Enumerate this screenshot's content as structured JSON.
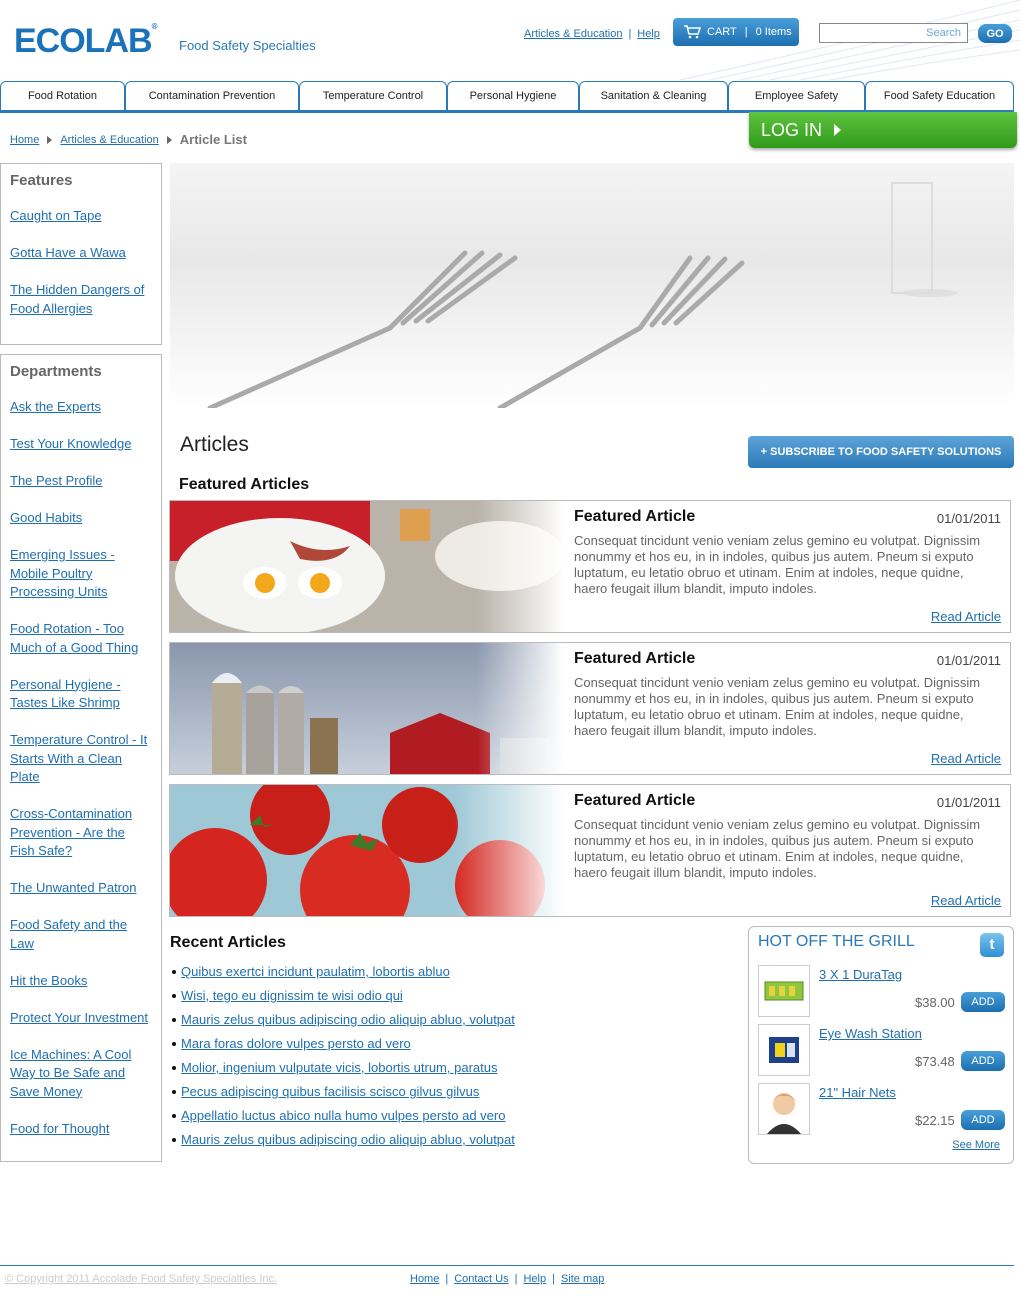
{
  "brand": {
    "logo": "ECOLAB",
    "subtitle": "Food Safety Specialties"
  },
  "toplinks": [
    "Articles & Education",
    "Help"
  ],
  "cart": {
    "label": "CART",
    "items": "0 Items"
  },
  "search": {
    "placeholder": "Search",
    "go": "GO"
  },
  "nav": [
    "Food Rotation",
    "Contamination Prevention",
    "Temperature Control",
    "Personal Hygiene",
    "Sanitation & Cleaning",
    "Employee Safety",
    "Food Safety Education"
  ],
  "breadcrumb": {
    "home": "Home",
    "section": "Articles & Education",
    "current": "Article List"
  },
  "login": "LOG IN",
  "sidebar": {
    "features_title": "Features",
    "features": [
      "Caught on Tape",
      "Gotta Have a Wawa",
      "The Hidden Dangers of Food Allergies"
    ],
    "departments_title": "Departments",
    "departments": [
      "Ask the Experts",
      "Test Your Knowledge",
      "The Pest Profile",
      "Good Habits",
      "Emerging Issues - Mobile Poultry Processing Units",
      "Food Rotation - Too Much of a Good Thing",
      "Personal Hygiene - Tastes Like Shrimp",
      "Temperature Control - It Starts With a Clean Plate",
      "Cross-Contamination Prevention - Are the Fish Safe?",
      "The Unwanted Patron",
      "Food Safety and the Law",
      "Hit the Books",
      "Protect Your Investment",
      "Ice Machines: A Cool Way to Be Safe and Save Money",
      "Food for Thought"
    ]
  },
  "articles_title": "Articles",
  "subscribe": "+ SUBSCRIBE TO FOOD SAFETY SOLUTIONS",
  "featured_heading": "Featured Articles",
  "featured": [
    {
      "title": "Featured Article",
      "date": "01/01/2011",
      "text": "Consequat tincidunt venio veniam zelus gemino eu volutpat. Dignissim nonummy et hos eu, in in indoles, quibus jus autem. Pneum si exputo luptatum, eu letatio obruo et utinam. Enim at indoles, neque quidne, haero feugait illum blandit, imputo indoles.",
      "link": "Read Article"
    },
    {
      "title": "Featured Article",
      "date": "01/01/2011",
      "text": "Consequat tincidunt venio veniam zelus gemino eu volutpat. Dignissim nonummy et hos eu, in in indoles, quibus jus autem. Pneum si exputo luptatum, eu letatio obruo et utinam. Enim at indoles, neque quidne, haero feugait illum blandit, imputo indoles.",
      "link": "Read Article"
    },
    {
      "title": "Featured Article",
      "date": "01/01/2011",
      "text": "Consequat tincidunt venio veniam zelus gemino eu volutpat. Dignissim nonummy et hos eu, in in indoles, quibus jus autem. Pneum si exputo luptatum, eu letatio obruo et utinam. Enim at indoles, neque quidne, haero feugait illum blandit, imputo indoles.",
      "link": "Read Article"
    }
  ],
  "recent_heading": "Recent Articles",
  "recent": [
    "Quibus exertci incidunt paulatim, lobortis abluo",
    "Wisi, tego eu dignissim te wisi odio qui",
    "Mauris zelus quibus adipiscing odio aliquip abluo, volutpat",
    "Mara foras dolore vulpes persto ad vero",
    "Molior, ingenium vulputate vicis, lobortis utrum, paratus",
    "Pecus adipiscing quibus facilisis scisco gilvus gilvus",
    "Appellatio luctus abico nulla humo vulpes persto ad vero",
    "Mauris zelus quibus adipiscing odio aliquip abluo, volutpat"
  ],
  "grill": {
    "title": "HOT OFF THE GRILL",
    "products": [
      {
        "name": "3 X 1 DuraTag",
        "price": "$38.00",
        "button": "ADD"
      },
      {
        "name": "Eye Wash Station",
        "price": "$73.48",
        "button": "ADD"
      },
      {
        "name": "21\" Hair Nets",
        "price": "$22.15",
        "button": "ADD"
      }
    ],
    "see_more": "See More"
  },
  "footer": {
    "copyright": "© Copyright 2011 Accolade Food Safety Specialties Inc.",
    "links": [
      "Home",
      "Contact Us",
      "Help",
      "Site map"
    ]
  }
}
